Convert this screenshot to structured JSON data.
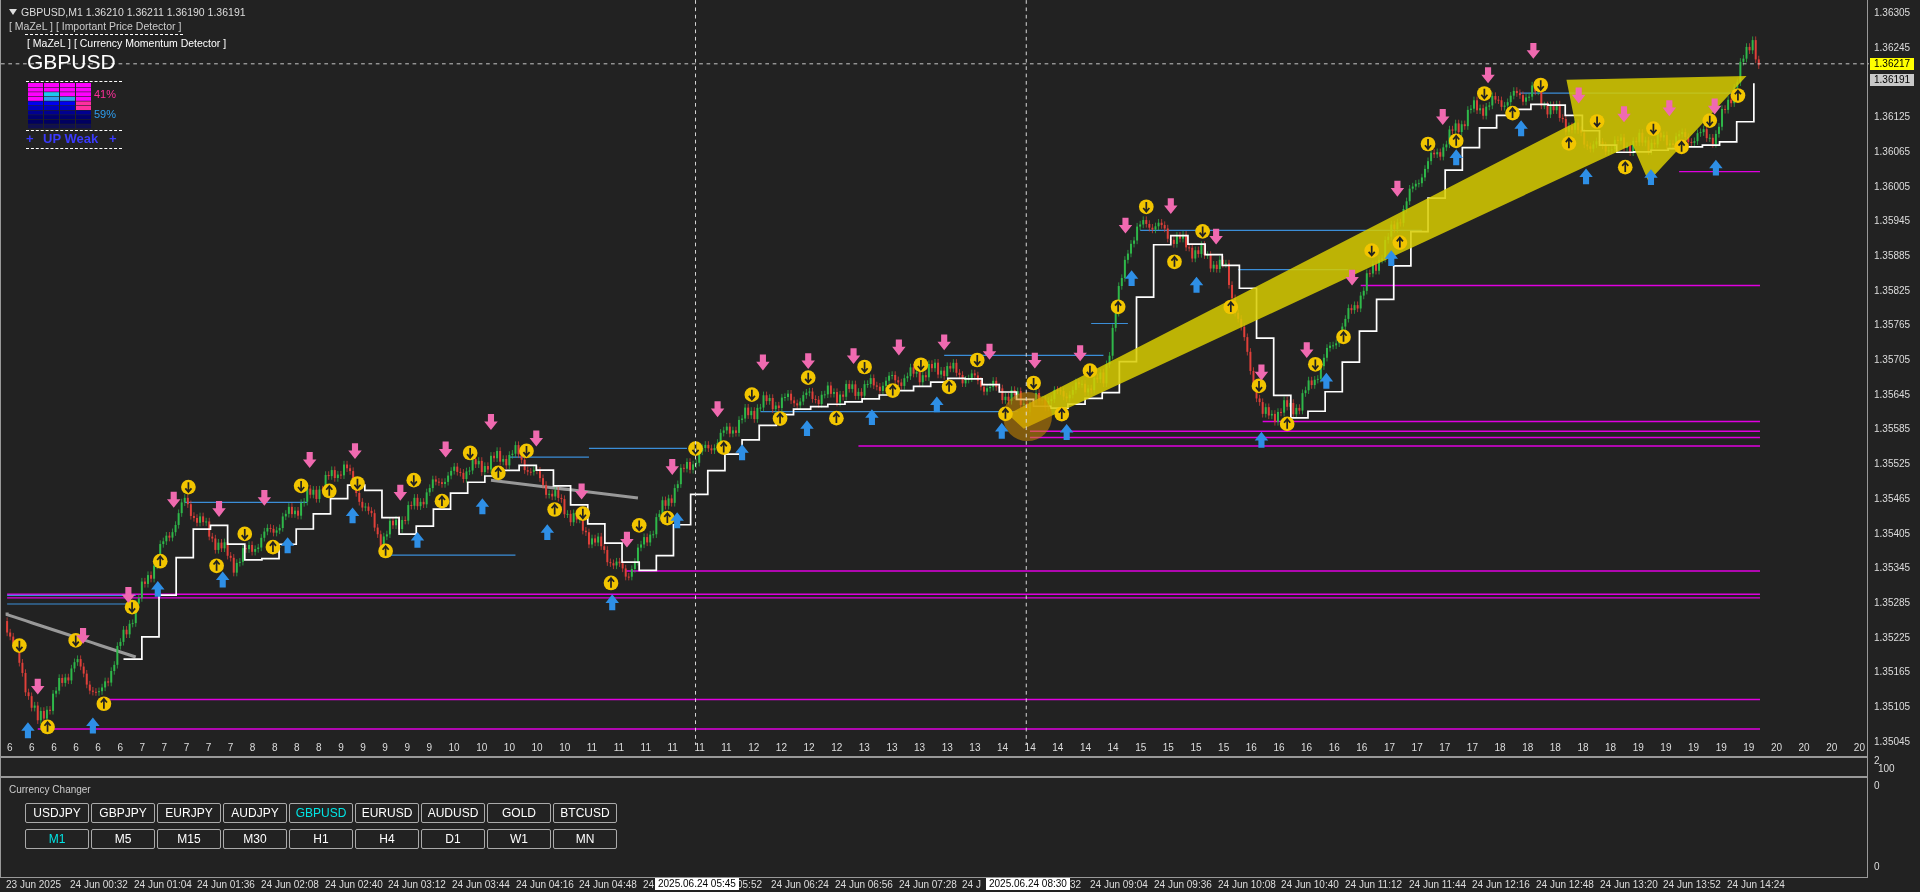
{
  "chart": {
    "symbol_line": "GBPUSD,M1  1.36210 1.36211 1.36190 1.36191",
    "indicators": [
      "[ MaZeL ] [ Important Price Detector ]",
      "[ MaZeL ] [ Currency Momentum Detector ]"
    ],
    "symbol": "GBPUSD",
    "strength": {
      "plus_left": "+",
      "signal": "UP Weak",
      "plus_right": "+",
      "up_percent": "41%",
      "down_percent": "59%"
    },
    "price_axis": [
      "1.36305",
      "1.36245",
      "1.36125",
      "1.36065",
      "1.36005",
      "1.35945",
      "1.35885",
      "1.35825",
      "1.35765",
      "1.35705",
      "1.35645",
      "1.35585",
      "1.35525",
      "1.35465",
      "1.35405",
      "1.35345",
      "1.35285",
      "1.35225",
      "1.35165",
      "1.35105",
      "1.35045"
    ],
    "ask_price": "1.36217",
    "bid_price": "1.36191",
    "hour_marks": [
      "6",
      "6",
      "6",
      "6",
      "6",
      "6",
      "7",
      "7",
      "7",
      "7",
      "7",
      "8",
      "8",
      "8",
      "8",
      "9",
      "9",
      "9",
      "9",
      "9",
      "10",
      "10",
      "10",
      "10",
      "10",
      "11",
      "11",
      "11",
      "11",
      "11",
      "11",
      "12",
      "12",
      "12",
      "12",
      "13",
      "13",
      "13",
      "13",
      "13",
      "14",
      "14",
      "14",
      "14",
      "14",
      "15",
      "15",
      "15",
      "15",
      "16",
      "16",
      "16",
      "16",
      "16",
      "17",
      "17",
      "17",
      "17",
      "18",
      "18",
      "18",
      "18",
      "18",
      "19",
      "19",
      "19",
      "19",
      "19",
      "20",
      "20",
      "20",
      "20"
    ]
  },
  "subwindow": {
    "axis_labels": [
      "2",
      "100"
    ]
  },
  "currency_changer": {
    "title": "Currency Changer",
    "axis_labels": [
      "0",
      "0"
    ],
    "symbols": [
      {
        "label": "USDJPY",
        "selected": false
      },
      {
        "label": "GBPJPY",
        "selected": false
      },
      {
        "label": "EURJPY",
        "selected": false
      },
      {
        "label": "AUDJPY",
        "selected": false
      },
      {
        "label": "GBPUSD",
        "selected": true
      },
      {
        "label": "EURUSD",
        "selected": false
      },
      {
        "label": "AUDUSD",
        "selected": false
      },
      {
        "label": "GOLD",
        "selected": false
      },
      {
        "label": "BTCUSD",
        "selected": false
      }
    ],
    "timeframes": [
      {
        "label": "M1",
        "selected": true
      },
      {
        "label": "M5",
        "selected": false
      },
      {
        "label": "M15",
        "selected": false
      },
      {
        "label": "M30",
        "selected": false
      },
      {
        "label": "H1",
        "selected": false
      },
      {
        "label": "H4",
        "selected": false
      },
      {
        "label": "D1",
        "selected": false
      },
      {
        "label": "W1",
        "selected": false
      },
      {
        "label": "MN",
        "selected": false
      }
    ]
  },
  "time_axis": {
    "labels": [
      "23 Jun 2025",
      "24 Jun 00:32",
      "24 Jun 01:04",
      "24 Jun 01:36",
      "24 Jun 02:08",
      "24 Jun 02:40",
      "24 Jun 03:12",
      "24 Jun 03:44",
      "24 Jun 04:16",
      "24 Jun 04:48",
      "24",
      "05:52",
      "24 Jun 06:24",
      "24 Jun 06:56",
      "24 Jun 07:28",
      "24 J",
      "32",
      "24 Jun 09:04",
      "24 Jun 09:36",
      "24 Jun 10:08",
      "24 Jun 10:40",
      "24 Jun 11:12",
      "24 Jun 11:44",
      "24 Jun 12:16",
      "24 Jun 12:48",
      "24 Jun 13:20",
      "24 Jun 13:52",
      "24 Jun 14:24"
    ],
    "cursor_labels": [
      "2025.06.24 05:45",
      "2025.06.24 08:30"
    ]
  }
}
